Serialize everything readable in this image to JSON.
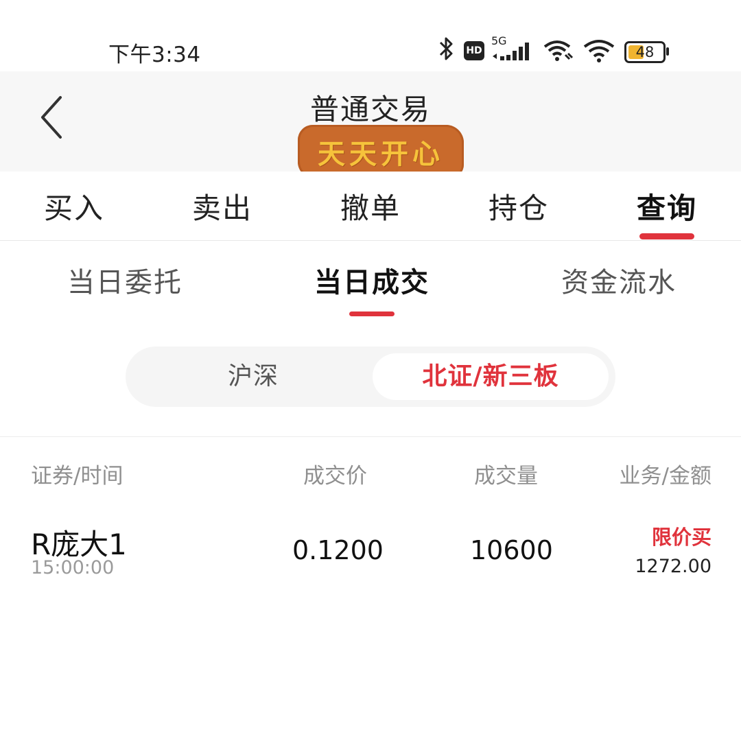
{
  "status_bar": {
    "time": "下午3:34",
    "battery": "48",
    "icons": [
      "bluetooth-icon",
      "hd-icon",
      "5g-signal-icon",
      "wifi-link-icon",
      "wifi-icon",
      "battery-icon"
    ],
    "network_label": "5G",
    "hd_label": "HD"
  },
  "header": {
    "title": "普通交易",
    "sticker_text": "天天开心",
    "sticker_color": "#c96a2c"
  },
  "main_tabs": [
    {
      "label": "买入"
    },
    {
      "label": "卖出"
    },
    {
      "label": "撤单"
    },
    {
      "label": "持仓"
    },
    {
      "label": "查询",
      "active": true
    }
  ],
  "sub_tabs": [
    {
      "label": "当日委托"
    },
    {
      "label": "当日成交",
      "active": true
    },
    {
      "label": "资金流水"
    }
  ],
  "segment": {
    "options": [
      "沪深",
      "北证/新三板"
    ],
    "selected": "北证/新三板"
  },
  "table": {
    "headers": [
      "证券/时间",
      "成交价",
      "成交量",
      "业务/金额"
    ],
    "rows": [
      {
        "name": "R庞大1",
        "time": "15:00:00",
        "price": "0.1200",
        "volume": "10600",
        "business": "限价买",
        "amount": "1272.00"
      }
    ]
  },
  "colors": {
    "accent": "#e0333c",
    "header_bg": "#f7f7f7"
  }
}
